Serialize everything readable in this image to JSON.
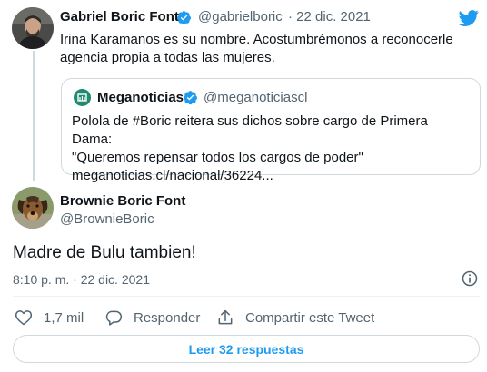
{
  "parent_tweet": {
    "author_name": "Gabriel Boric Font",
    "author_handle": "@gabrielboric",
    "date": "· 22 dic. 2021",
    "text_line1": "Irina Karamanos es su nombre. Acostumbrémonos a reconocerle",
    "text_line2": "agencia propia a todas las mujeres."
  },
  "quoted_tweet": {
    "author_name": "Meganoticias",
    "author_handle": "@meganoticiascl",
    "text_line1": "Polola de #Boric reitera sus dichos sobre cargo de Primera Dama:",
    "text_line2": "\"Queremos repensar todos los cargos de poder\"",
    "text_line3": "meganoticias.cl/nacional/36224..."
  },
  "main_tweet": {
    "author_name": "Brownie Boric Font",
    "author_handle": "@BrownieBoric",
    "text": "Madre de Bulu tambien!",
    "timestamp": "8:10 p. m. · 22 dic. 2021"
  },
  "actions": {
    "like_count": "1,7 mil",
    "reply_label": "Responder",
    "share_label": "Compartir este Tweet"
  },
  "read_replies_label": "Leer 32 respuestas",
  "colors": {
    "accent": "#1d9bf0",
    "text_primary": "#0f1419",
    "text_secondary": "#536471",
    "border": "#cfd9de"
  },
  "icons": [
    "twitter-logo-icon",
    "verified-badge-icon",
    "info-icon",
    "heart-icon",
    "reply-icon",
    "share-icon"
  ]
}
